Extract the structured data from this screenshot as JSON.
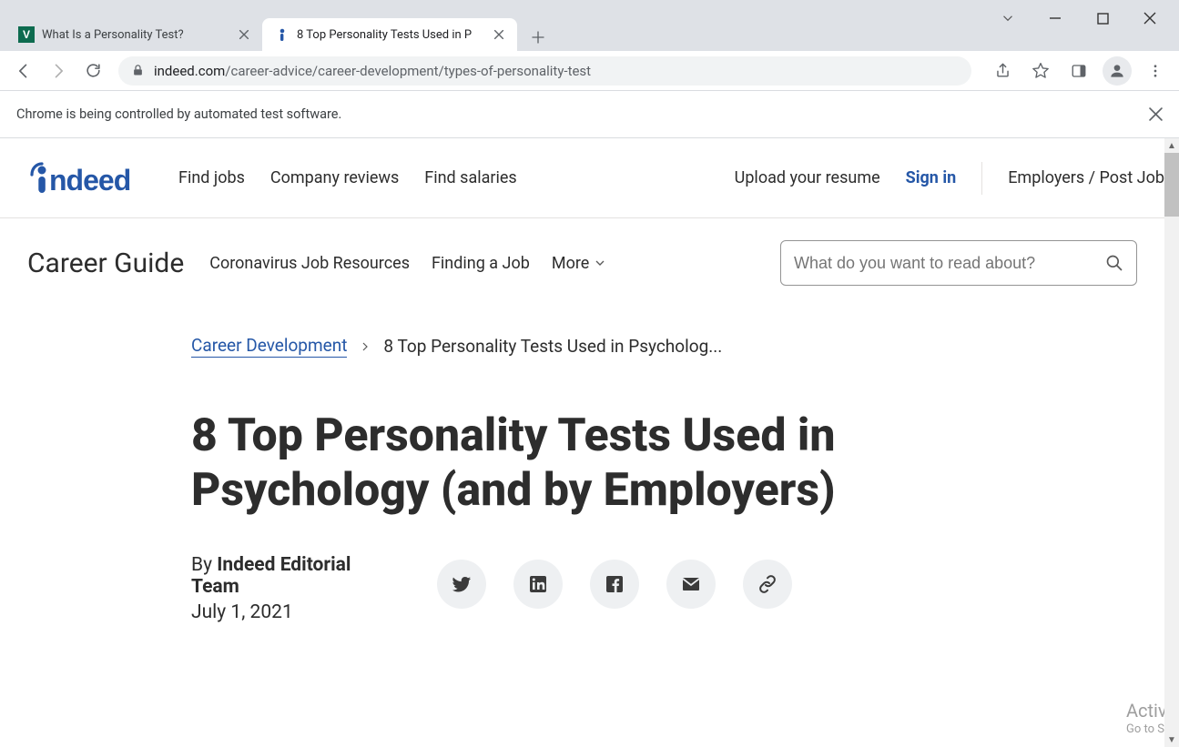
{
  "browser": {
    "tabs": [
      {
        "title": "What Is a Personality Test?",
        "active": false,
        "favicon": "V"
      },
      {
        "title": "8 Top Personality Tests Used in P",
        "active": true,
        "favicon": "i"
      }
    ],
    "url_host": "indeed.com",
    "url_path": "/career-advice/career-development/types-of-personality-test",
    "infobar_text": "Chrome is being controlled by automated test software."
  },
  "site_nav": {
    "logo": "indeed",
    "primary": [
      "Find jobs",
      "Company reviews",
      "Find salaries"
    ],
    "right": {
      "upload": "Upload your resume",
      "signin": "Sign in",
      "employers": "Employers / Post Job"
    },
    "career_guide": "Career Guide",
    "subnav": [
      "Coronavirus Job Resources",
      "Finding a Job"
    ],
    "more": "More",
    "search_placeholder": "What do you want to read about?"
  },
  "breadcrumb": {
    "parent": "Career Development",
    "current": "8 Top Personality Tests Used in Psycholog..."
  },
  "article": {
    "title": "8 Top Personality Tests Used in Psychology (and by Employers)",
    "byline_prefix": "By ",
    "author": "Indeed Editorial Team",
    "date": "July 1, 2021"
  },
  "watermark": {
    "line1": "Activa",
    "line2": "Go to Se"
  }
}
